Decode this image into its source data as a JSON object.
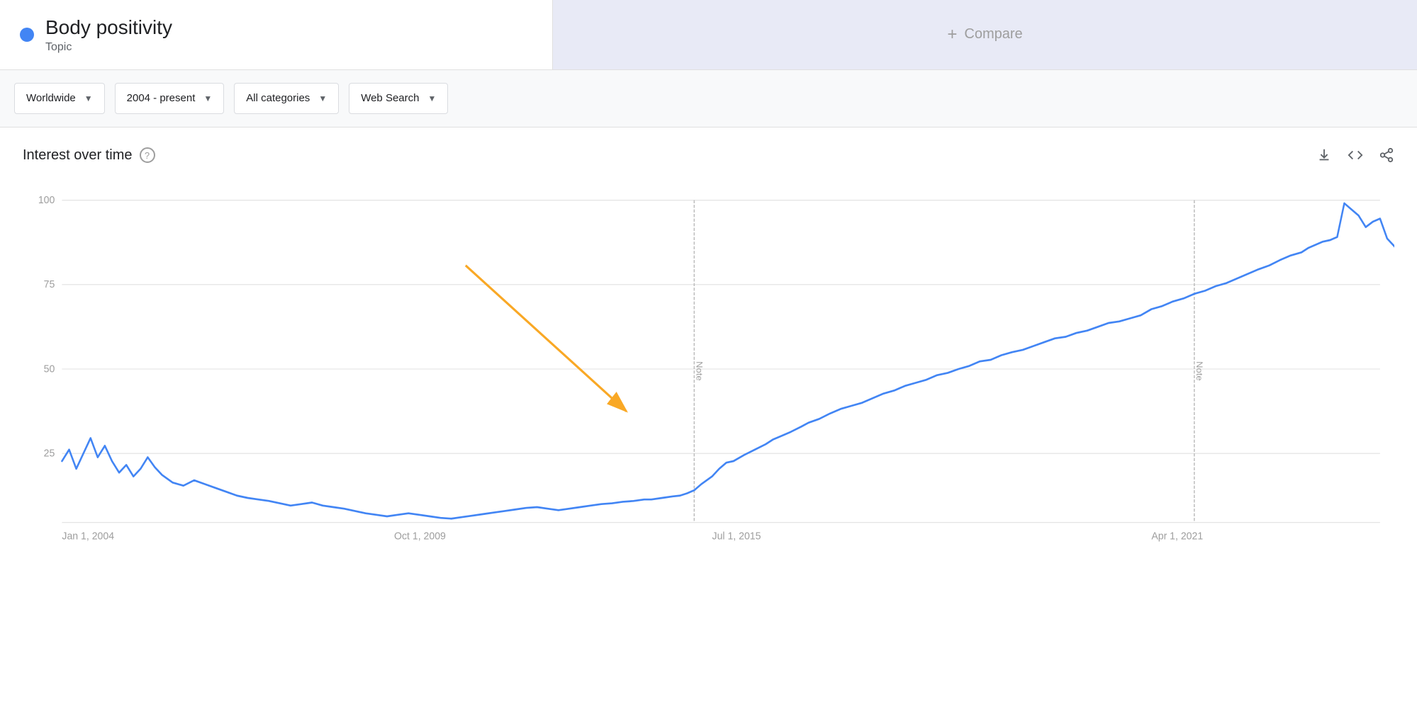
{
  "topBar": {
    "term": {
      "name": "Body positivity",
      "type": "Topic",
      "dotColor": "#4285f4"
    },
    "compare": {
      "label": "Compare",
      "plusSymbol": "+"
    }
  },
  "filters": {
    "region": {
      "label": "Worldwide",
      "arrowSymbol": "▼"
    },
    "period": {
      "label": "2004 - present",
      "arrowSymbol": "▼"
    },
    "category": {
      "label": "All categories",
      "arrowSymbol": "▼"
    },
    "searchType": {
      "label": "Web Search",
      "arrowSymbol": "▼"
    }
  },
  "chart": {
    "title": "Interest over time",
    "helpTooltip": "?",
    "yAxis": {
      "labels": [
        "100",
        "75",
        "50",
        "25",
        ""
      ]
    },
    "xAxis": {
      "labels": [
        "Jan 1, 2004",
        "Oct 1, 2009",
        "Jul 1, 2015",
        "Apr 1, 2021"
      ]
    },
    "actions": {
      "download": "download-icon",
      "embed": "embed-icon",
      "share": "share-icon"
    },
    "noteLines": [
      {
        "x": 0.49,
        "label": "Note"
      },
      {
        "x": 0.86,
        "label": "Note"
      }
    ],
    "arrow": {
      "color": "#f9a825",
      "fromX": 0.355,
      "fromY": 0.25,
      "toX": 0.44,
      "toY": 0.62
    }
  }
}
